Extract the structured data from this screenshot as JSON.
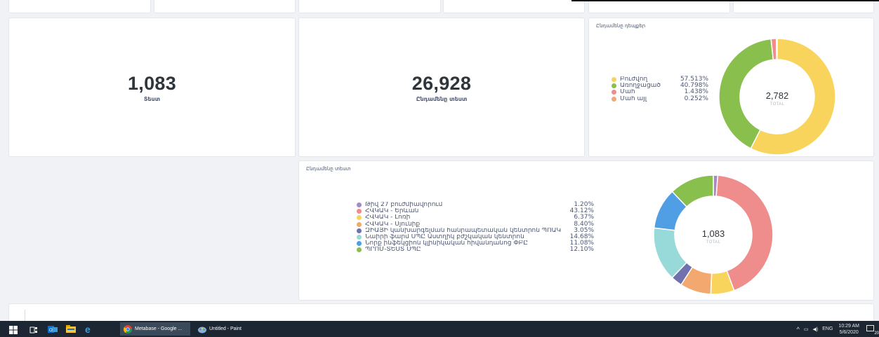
{
  "colors": {
    "yellow": "#f9d45c",
    "green": "#88bf4d",
    "pink": "#ef8c8c",
    "orange": "#f2a86f",
    "purple": "#a989c5",
    "indigo": "#7172ad",
    "cyan": "#98d9d9",
    "blue": "#509ee3"
  },
  "scalar_1": {
    "value": "1,083",
    "label": "Տեստ"
  },
  "scalar_2": {
    "value": "26,928",
    "label": "Ընդամենը տեստ"
  },
  "chart_data": [
    {
      "type": "pie",
      "title": "Ընդամենը դեպքեր",
      "total_value": "2,782",
      "total_label": "TOTAL",
      "legend_placement": "left",
      "slices": [
        {
          "name": "Բուժվող",
          "percent_label": "57.513%",
          "value": 57.513,
          "color": "#f9d45c"
        },
        {
          "name": "Առողջացած",
          "percent_label": "40.798%",
          "value": 40.798,
          "color": "#88bf4d"
        },
        {
          "name": "Մահ",
          "percent_label": "1.438%",
          "value": 1.438,
          "color": "#ef8c8c"
        },
        {
          "name": "Մահ այլ",
          "percent_label": "0.252%",
          "value": 0.252,
          "color": "#f2a86f"
        }
      ]
    },
    {
      "type": "pie",
      "title": "Ընդամենը տեստ",
      "total_value": "1,083",
      "total_label": "TOTAL",
      "legend_placement": "left",
      "slices": [
        {
          "name": "Թիվ 27 բուժմիավորում",
          "percent_label": "1.20%",
          "value": 1.2,
          "color": "#a989c5"
        },
        {
          "name": "ՀՎԿԱԿ - Երևան",
          "percent_label": "43.12%",
          "value": 43.12,
          "color": "#ef8c8c"
        },
        {
          "name": "ՀՎԿԱԿ - Լոռի",
          "percent_label": "6.37%",
          "value": 6.37,
          "color": "#f9d45c"
        },
        {
          "name": "ՀՎԿԱԿ - Սյունիք",
          "percent_label": "8.40%",
          "value": 8.4,
          "color": "#f2a86f"
        },
        {
          "name": "ԶԻԱՅԻ կանխարգելման հանրապետական կենտրոն ՊՈԱԿ",
          "percent_label": "3.05%",
          "value": 3.05,
          "color": "#7172ad"
        },
        {
          "name": "Նաիրի ֆարմ ՍՊԸ Աստղիկ բժշկական կենտրոն",
          "percent_label": "14.68%",
          "value": 14.68,
          "color": "#98d9d9"
        },
        {
          "name": "Նորք ինֆեկցիոն կլինիկական հիվանդանոց ՓԲԸ",
          "percent_label": "11.08%",
          "value": 11.08,
          "color": "#509ee3"
        },
        {
          "name": "ՊՐՈՄ-ՏԵՍՏ ՍՊԸ",
          "percent_label": "12.10%",
          "value": 12.1,
          "color": "#88bf4d"
        }
      ]
    }
  ],
  "taskbar": {
    "apps": [
      {
        "label": "Metabase - Google ...",
        "icon": "chrome-icon"
      },
      {
        "label": "Untitled - Paint",
        "icon": "paint-icon"
      }
    ],
    "pinned_icons": [
      "windows-start-icon",
      "task-view-icon",
      "outlook-icon",
      "file-explorer-icon",
      "edge-icon"
    ],
    "tray": {
      "language": "ENG",
      "time": "10:29 AM",
      "date": "5/6/2020",
      "notification_count": "20"
    }
  }
}
